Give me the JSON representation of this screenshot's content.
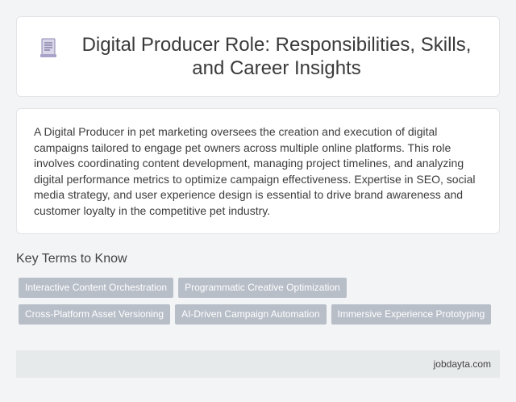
{
  "header": {
    "icon": "document-icon",
    "title": "Digital Producer Role: Responsibilities, Skills, and Career Insights"
  },
  "description": "A Digital Producer in pet marketing oversees the creation and execution of digital campaigns tailored to engage pet owners across multiple online platforms. This role involves coordinating content development, managing project timelines, and analyzing digital performance metrics to optimize campaign effectiveness. Expertise in SEO, social media strategy, and user experience design is essential to drive brand awareness and customer loyalty in the competitive pet industry.",
  "key_terms": {
    "heading": "Key Terms to Know",
    "tags": [
      "Interactive Content Orchestration",
      "Programmatic Creative Optimization",
      "Cross-Platform Asset Versioning",
      "AI-Driven Campaign Automation",
      "Immersive Experience Prototyping"
    ]
  },
  "footer": {
    "site": "jobdayta.com"
  },
  "colors": {
    "background": "#f3f4f6",
    "card": "#ffffff",
    "tag": "#b8bec8",
    "footer": "#e7eaea"
  }
}
